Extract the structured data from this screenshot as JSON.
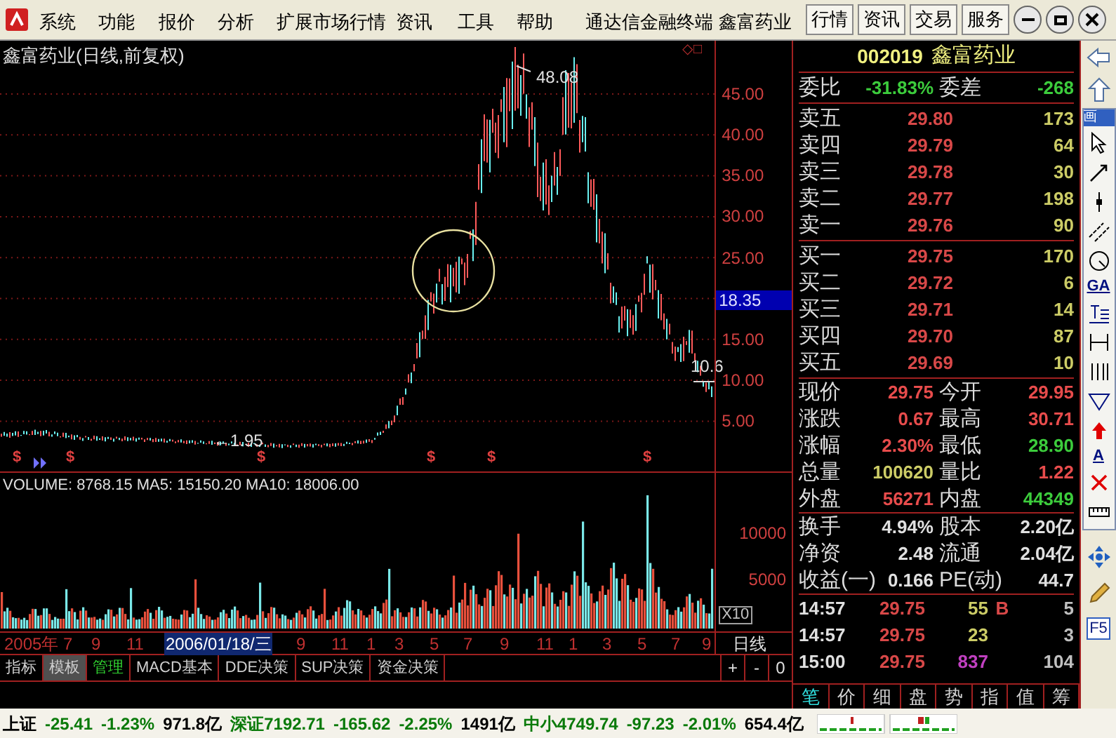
{
  "menu_bar": {
    "items": [
      "系统",
      "功能",
      "报价",
      "分析",
      "扩展市场行情",
      "资讯",
      "工具",
      "帮助",
      "通达信金融终端",
      "鑫富药业"
    ],
    "buttons": [
      "行情",
      "资讯",
      "交易",
      "服务"
    ]
  },
  "chart": {
    "title": "鑫富药业(日线,前复权)",
    "corner_symbols": "◇□",
    "high_label": "48.08",
    "low_label": "←1.95",
    "last_label": "10.6",
    "price_ticks": [
      "45.00",
      "40.00",
      "35.00",
      "30.00",
      "25.00",
      "15.00",
      "10.00",
      "5.00"
    ],
    "current_price_tag": "18.35",
    "event_markers": [
      "$",
      "$",
      "$",
      "$",
      "$",
      "$"
    ],
    "volume_legend": "VOLUME: 8768.15 MA5: 15150.20 MA10: 18006.00",
    "volume_ticks": [
      "10000",
      "5000"
    ],
    "volume_unit": "X10",
    "date_labels": [
      "2005年",
      "7",
      "9",
      "11",
      "9",
      "11",
      "1",
      "3",
      "5",
      "7",
      "9",
      "11",
      "1",
      "3",
      "5",
      "7",
      "9"
    ],
    "cursor_date": "2006/01/18/三",
    "period": "日线"
  },
  "bottom_tabs": [
    {
      "label": "指标",
      "selected": false,
      "accent": false
    },
    {
      "label": "模板",
      "selected": true,
      "accent": false
    },
    {
      "label": "管理",
      "selected": false,
      "accent": true
    },
    {
      "label": "MACD基本",
      "selected": false,
      "accent": false
    },
    {
      "label": "DDE决策",
      "selected": false,
      "accent": false
    },
    {
      "label": "SUP决策",
      "selected": false,
      "accent": false
    },
    {
      "label": "资金决策",
      "selected": false,
      "accent": false
    }
  ],
  "zoom_buttons": [
    "+",
    "-",
    "0"
  ],
  "quote": {
    "code": "002019",
    "name": "鑫富药业",
    "ratio": [
      {
        "label": "委比",
        "value": "-31.83%",
        "color": "#3ccc3c"
      },
      {
        "label": "委差",
        "value": "-268",
        "color": "#3ccc3c"
      }
    ],
    "asks": [
      {
        "label": "卖五",
        "price": "29.80",
        "volume": "173"
      },
      {
        "label": "卖四",
        "price": "29.79",
        "volume": "64"
      },
      {
        "label": "卖三",
        "price": "29.78",
        "volume": "30"
      },
      {
        "label": "卖二",
        "price": "29.77",
        "volume": "198"
      },
      {
        "label": "卖一",
        "price": "29.76",
        "volume": "90"
      }
    ],
    "bids": [
      {
        "label": "买一",
        "price": "29.75",
        "volume": "170"
      },
      {
        "label": "买二",
        "price": "29.72",
        "volume": "6"
      },
      {
        "label": "买三",
        "price": "29.71",
        "volume": "14"
      },
      {
        "label": "买四",
        "price": "29.70",
        "volume": "87"
      },
      {
        "label": "买五",
        "price": "29.69",
        "volume": "10"
      }
    ],
    "stats": [
      [
        {
          "label": "现价",
          "value": "29.75",
          "color": "#e84c4c"
        },
        {
          "label": "今开",
          "value": "29.95",
          "color": "#e84c4c"
        }
      ],
      [
        {
          "label": "涨跌",
          "value": "0.67",
          "color": "#e84c4c"
        },
        {
          "label": "最高",
          "value": "30.71",
          "color": "#e84c4c"
        }
      ],
      [
        {
          "label": "涨幅",
          "value": "2.30%",
          "color": "#e84c4c"
        },
        {
          "label": "最低",
          "value": "28.90",
          "color": "#3ccc3c"
        }
      ],
      [
        {
          "label": "总量",
          "value": "100620",
          "color": "#cccc66"
        },
        {
          "label": "量比",
          "value": "1.22",
          "color": "#e84c4c"
        }
      ],
      [
        {
          "label": "外盘",
          "value": "56271",
          "color": "#e84c4c"
        },
        {
          "label": "内盘",
          "value": "44349",
          "color": "#3ccc3c"
        }
      ]
    ],
    "finance": [
      [
        {
          "label": "换手",
          "value": "4.94%",
          "color": "#e0e0e0"
        },
        {
          "label": "股本",
          "value": "2.20亿",
          "color": "#e0e0e0"
        }
      ],
      [
        {
          "label": "净资",
          "value": "2.48",
          "color": "#e0e0e0"
        },
        {
          "label": "流通",
          "value": "2.04亿",
          "color": "#e0e0e0"
        }
      ],
      [
        {
          "label": "收益(一)",
          "value": "0.166",
          "color": "#e0e0e0"
        },
        {
          "label": "PE(动)",
          "value": "44.7",
          "color": "#e0e0e0"
        }
      ]
    ],
    "ticks": [
      {
        "time": "14:57",
        "price": "29.75",
        "volume": "55",
        "color": "#cccc66",
        "side": "B",
        "count": "5"
      },
      {
        "time": "14:57",
        "price": "29.75",
        "volume": "23",
        "color": "#cccc66",
        "count": "3"
      },
      {
        "time": "15:00",
        "price": "29.75",
        "volume": "837",
        "color": "#c040c0",
        "count": "104"
      }
    ],
    "tabs": [
      {
        "label": "笔",
        "selected": true
      },
      {
        "label": "价",
        "selected": false
      },
      {
        "label": "细",
        "selected": false
      },
      {
        "label": "盘",
        "selected": false
      },
      {
        "label": "势",
        "selected": false
      },
      {
        "label": "指",
        "selected": false
      },
      {
        "label": "值",
        "selected": false
      },
      {
        "label": "筹",
        "selected": false
      }
    ]
  },
  "toolbox": {
    "title": "画",
    "tools": [
      {
        "kind": "cursor"
      },
      {
        "kind": "line"
      },
      {
        "kind": "segment"
      },
      {
        "kind": "parallel"
      },
      {
        "kind": "circle"
      },
      {
        "kind": "text",
        "label": "GA"
      },
      {
        "kind": "textbox"
      },
      {
        "kind": "bracket"
      },
      {
        "kind": "bars"
      },
      {
        "kind": "triangle"
      },
      {
        "kind": "uparrow"
      },
      {
        "kind": "text",
        "label": "A"
      },
      {
        "kind": "delete"
      },
      {
        "kind": "ruler"
      }
    ]
  },
  "side_key": "F5",
  "status_bar": [
    {
      "text": "上证",
      "color": "#000000"
    },
    {
      "text": "-25.41",
      "color": "#0a7a0a"
    },
    {
      "text": "-1.23%",
      "color": "#0a7a0a"
    },
    {
      "text": "971.8亿",
      "color": "#000000"
    },
    {
      "text": "深证7192.71",
      "color": "#0a7a0a"
    },
    {
      "text": "-165.62",
      "color": "#0a7a0a"
    },
    {
      "text": "-2.25%",
      "color": "#0a7a0a"
    },
    {
      "text": "1491亿",
      "color": "#000000"
    },
    {
      "text": "中小4749.74",
      "color": "#0a7a0a"
    },
    {
      "text": "-97.23",
      "color": "#0a7a0a"
    },
    {
      "text": "-2.01%",
      "color": "#0a7a0a"
    },
    {
      "text": "654.4亿",
      "color": "#000000"
    }
  ]
}
